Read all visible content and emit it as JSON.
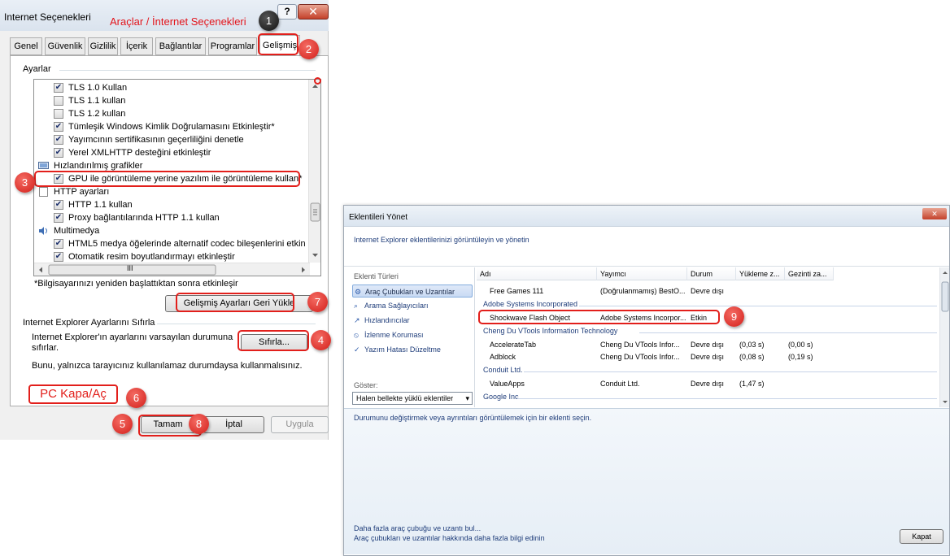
{
  "internet_options": {
    "title": "Internet Seçenekleri",
    "title_note": "Araçlar / İnternet Seçenekleri",
    "help_label": "?",
    "close_label": "✕",
    "tabs": [
      {
        "label": "Genel"
      },
      {
        "label": "Güvenlik"
      },
      {
        "label": "Gizlilik"
      },
      {
        "label": "İçerik"
      },
      {
        "label": "Bağlantılar"
      },
      {
        "label": "Programlar"
      },
      {
        "label": "Gelişmiş"
      }
    ],
    "active_tab": "Gelişmiş",
    "settings_group": "Ayarlar",
    "settings_rows": [
      {
        "label": "TLS 1.0 Kullan",
        "checked": "✔"
      },
      {
        "label": "TLS 1.1 kullan",
        "checked": ""
      },
      {
        "label": "TLS 1.2 kullan",
        "checked": ""
      },
      {
        "label": "Tümleşik Windows Kimlik Doğrulamasını Etkinleştir*",
        "checked": "✔"
      },
      {
        "label": "Yayımcının sertifikasının geçerliliğini denetle",
        "checked": "✔"
      },
      {
        "label": "Yerel XMLHTTP desteğini etkinleştir",
        "checked": "✔"
      },
      {
        "label": "Hızlandırılmış grafikler"
      },
      {
        "label": "GPU ile görüntüleme yerine yazılım ile görüntüleme kullan*",
        "checked": "✔"
      },
      {
        "label": "HTTP ayarları"
      },
      {
        "label": "HTTP 1.1 kullan",
        "checked": "✔"
      },
      {
        "label": "Proxy bağlantılarında HTTP 1.1 kullan",
        "checked": "✔"
      },
      {
        "label": "Multimedya"
      },
      {
        "label": "HTML5 medya öğelerinde alternatif codec bileşenlerini etkin",
        "checked": "✔"
      },
      {
        "label": "Otomatik resim boyutlandırmayı etkinleştir",
        "checked": "✔"
      }
    ],
    "hscroll_thumb": "III",
    "restart_note": "*Bilgisayarınızı yeniden başlattıktan sonra etkinleşir",
    "restore_button": "Gelişmiş Ayarları Geri Yükle",
    "reset_group": "Internet Explorer Ayarlarını Sıfırla",
    "reset_description": "Internet Explorer'ın ayarlarını varsayılan durumuna sıfırlar.",
    "reset_button": "Sıfırla...",
    "reset_warning": "Bunu, yalnızca tarayıcınız kullanılamaz durumdaysa kullanmalısınız.",
    "pc_note": "PC Kapa/Aç",
    "ok_button": "Tamam",
    "cancel_button": "İptal",
    "apply_button": "Uygula",
    "callouts": [
      "1",
      "2",
      "3",
      "4",
      "5",
      "6",
      "7",
      "8"
    ]
  },
  "manage_addons": {
    "title": "Eklentileri Yönet",
    "close_label": "✕",
    "header_text": "Internet Explorer eklentilerinizi görüntüleyin ve yönetin",
    "types_label": "Eklenti Türleri",
    "types": [
      {
        "label": "Araç Çubukları ve Uzantılar",
        "icon": "⚙"
      },
      {
        "label": "Arama Sağlayıcıları",
        "icon": "⌕"
      },
      {
        "label": "Hızlandırıcılar",
        "icon": "↗"
      },
      {
        "label": "İzlenme Koruması",
        "icon": "⦸"
      },
      {
        "label": "Yazım Hatası Düzeltme",
        "icon": "✓"
      }
    ],
    "show_label": "Göster:",
    "show_value": "Halen bellekte yüklü eklentiler",
    "columns": [
      "Adı",
      "Yayımcı",
      "Durum",
      "Yükleme z...",
      "Gezinti za..."
    ],
    "rows": [
      {
        "name": "Free Games 111",
        "publisher": "(Doğrulanmamış) BestO...",
        "status": "Devre dışı",
        "load": "",
        "nav": ""
      },
      {
        "group": "Adobe Systems Incorporated"
      },
      {
        "name": "Shockwave Flash Object",
        "publisher": "Adobe Systems Incorpor...",
        "status": "Etkin",
        "load": "",
        "nav": ""
      },
      {
        "group": "Cheng Du VTools Information Technology"
      },
      {
        "name": "AccelerateTab",
        "publisher": "Cheng Du VTools Infor...",
        "status": "Devre dışı",
        "load": "(0,03 s)",
        "nav": "(0,00 s)"
      },
      {
        "name": "Adblock",
        "publisher": "Cheng Du VTools Infor...",
        "status": "Devre dışı",
        "load": "(0,08 s)",
        "nav": "(0,19 s)"
      },
      {
        "group": "Conduit Ltd."
      },
      {
        "name": "ValueApps",
        "publisher": "Conduit Ltd.",
        "status": "Devre dışı",
        "load": "(1,47 s)",
        "nav": ""
      },
      {
        "group": "Google Inc"
      }
    ],
    "detail_prompt": "Durumunu değiştirmek veya ayrıntıları görüntülemek için bir eklenti seçin.",
    "link_find_more": "Daha fazla araç çubuğu ve uzantı bul...",
    "link_learn_more": "Araç çubukları ve uzantılar hakkında daha fazla bilgi edinin",
    "close_button": "Kapat",
    "callout": "9"
  },
  "colors": {
    "accent_red": "#e21f1b",
    "link_blue": "#1f3d7a"
  }
}
